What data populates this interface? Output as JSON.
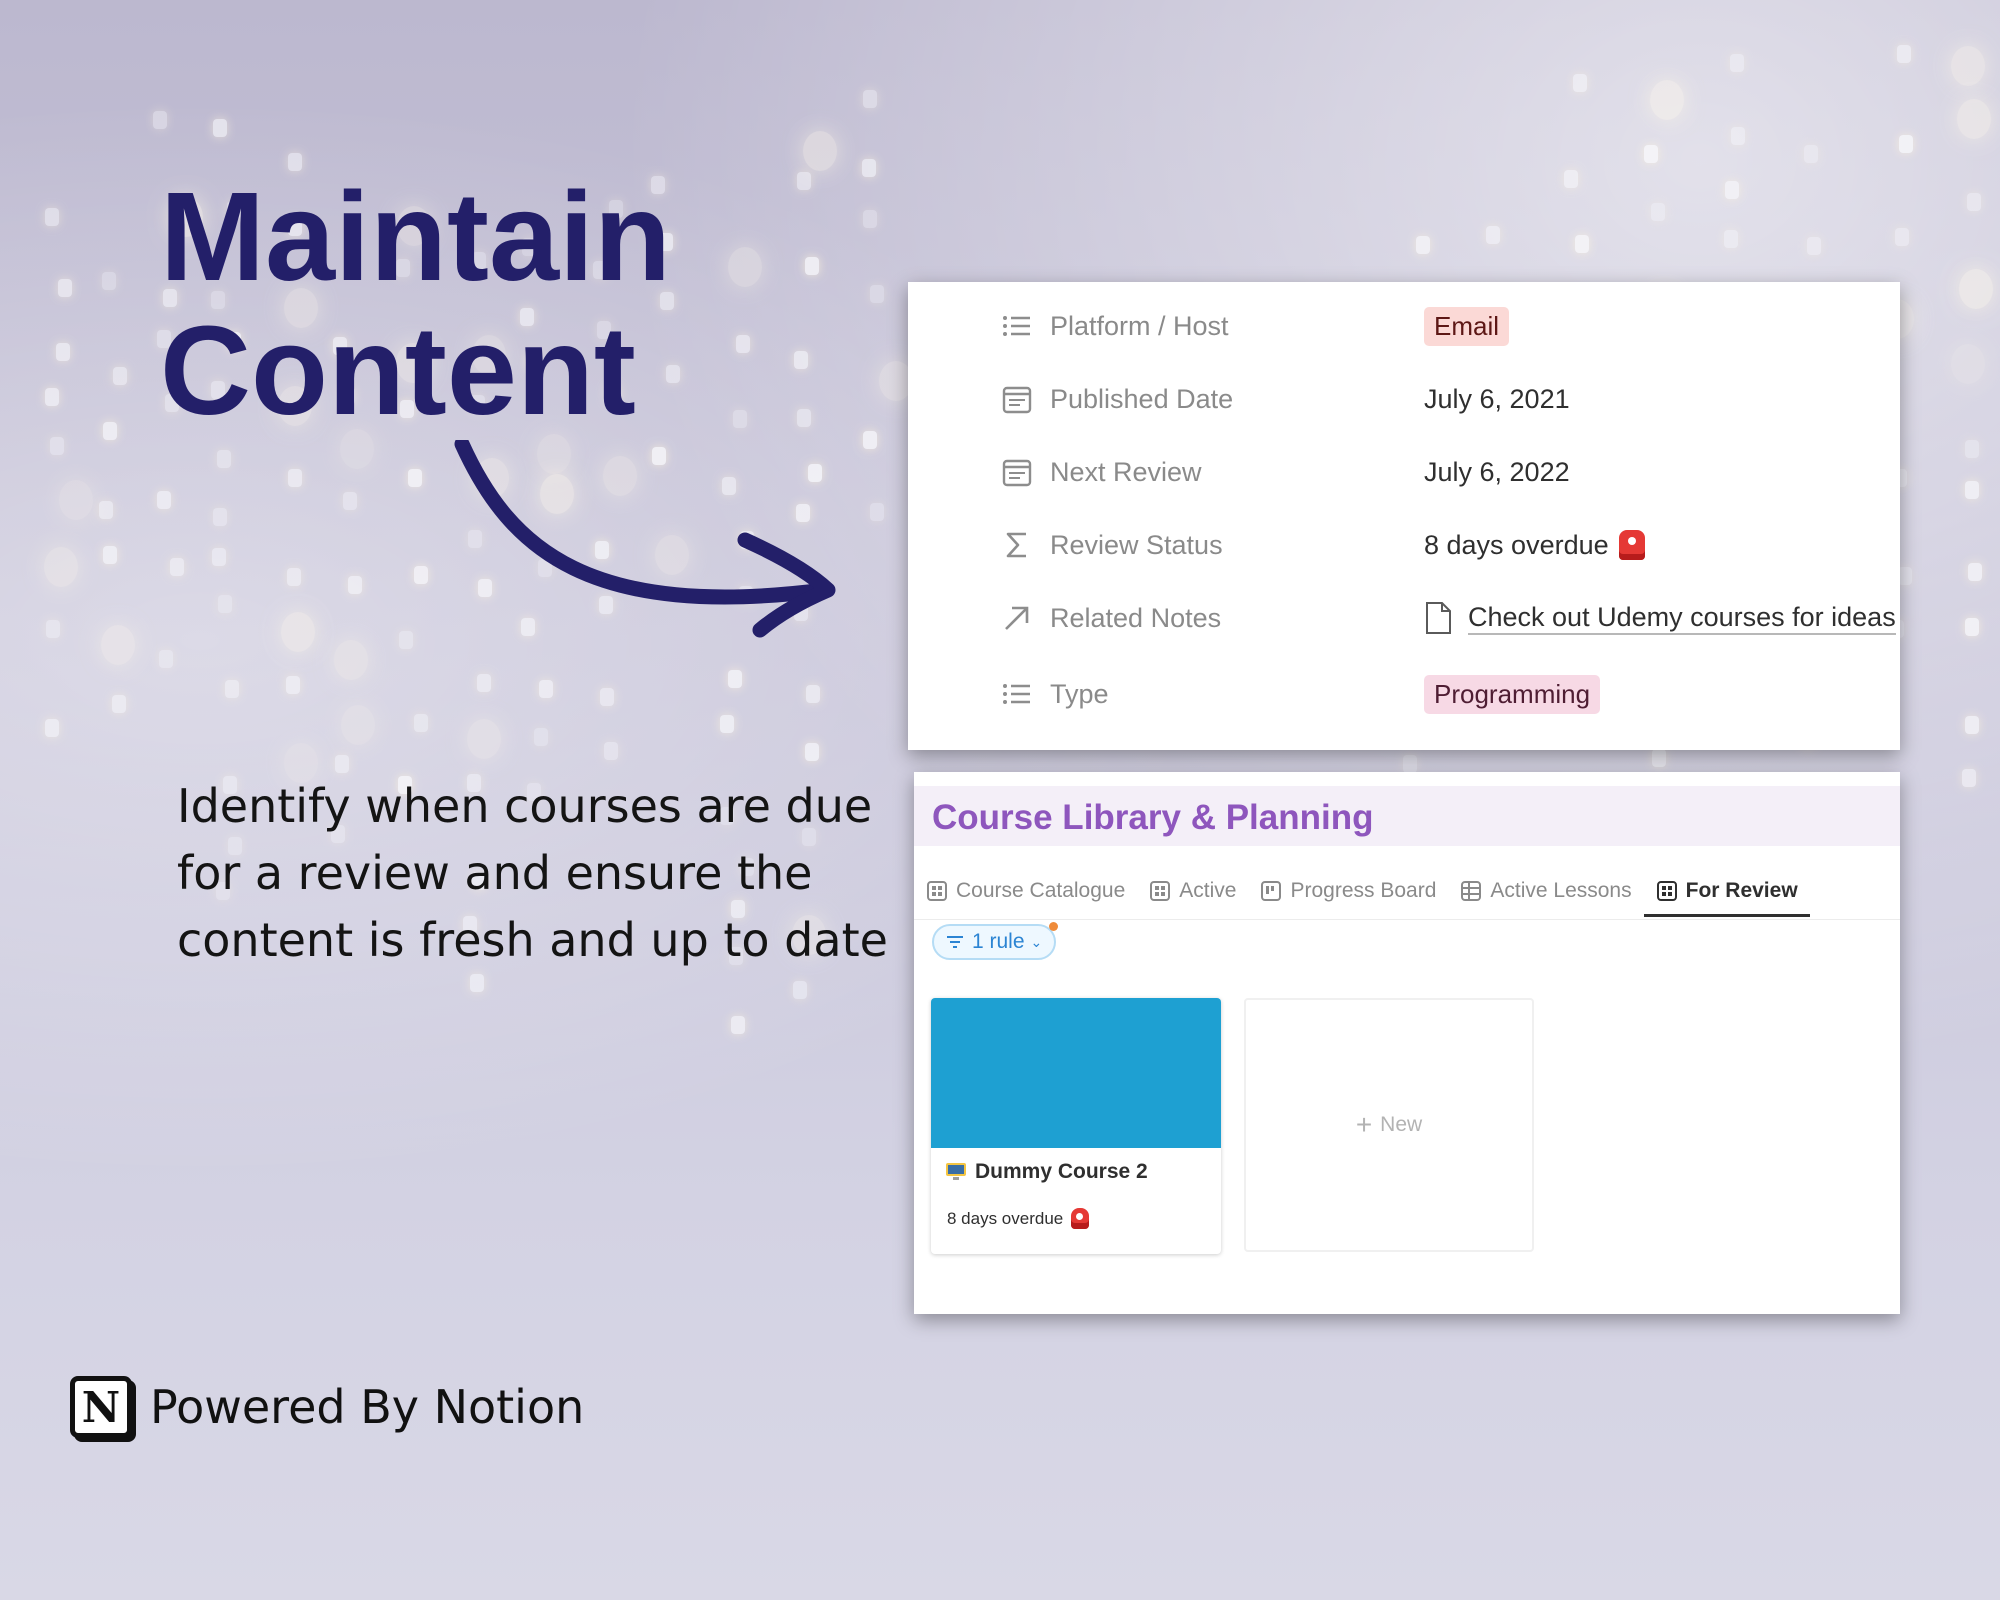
{
  "headline": {
    "line1": "Maintain",
    "line2": "Content"
  },
  "description": {
    "line1": "Identify when courses are due",
    "line2": "for a review and ensure the",
    "line3": "content is fresh and up to date"
  },
  "footer": {
    "powered_by": "Powered By Notion",
    "logo_letter": "N"
  },
  "properties": [
    {
      "label": "Platform / Host",
      "icon": "list-icon",
      "value": "Email",
      "kind": "tag",
      "color": "#fbd9d6"
    },
    {
      "label": "Published Date",
      "icon": "calendar-icon",
      "value": "July 6, 2021",
      "kind": "text"
    },
    {
      "label": "Next Review",
      "icon": "calendar-icon",
      "value": "July 6, 2022",
      "kind": "text"
    },
    {
      "label": "Review Status",
      "icon": "sigma-icon",
      "value": "8 days overdue",
      "kind": "text-siren"
    },
    {
      "label": "Related Notes",
      "icon": "arrow-up-right-icon",
      "value": "Check out Udemy courses for ideas",
      "kind": "link"
    },
    {
      "label": "Type",
      "icon": "list-icon",
      "value": "Programming",
      "kind": "tag",
      "color": "#f7d9e5"
    }
  ],
  "database": {
    "title": "Course Library & Planning",
    "title_color": "#8e56bd",
    "tabs": [
      {
        "label": "Course Catalogue",
        "icon": "gallery-icon",
        "active": false
      },
      {
        "label": "Active",
        "icon": "gallery-icon",
        "active": false
      },
      {
        "label": "Progress Board",
        "icon": "board-icon",
        "active": false
      },
      {
        "label": "Active Lessons",
        "icon": "table-icon",
        "active": false
      },
      {
        "label": "For Review",
        "icon": "gallery-icon",
        "active": true
      }
    ],
    "filter": {
      "label": "1 rule"
    },
    "card": {
      "title": "Dummy Course 2",
      "icon": "computer-icon",
      "status": "8 days overdue",
      "cover_color": "#1ea0d2"
    },
    "new_label": "New"
  },
  "colors": {
    "headline": "#231f69",
    "accent_siren": "#e53935"
  }
}
